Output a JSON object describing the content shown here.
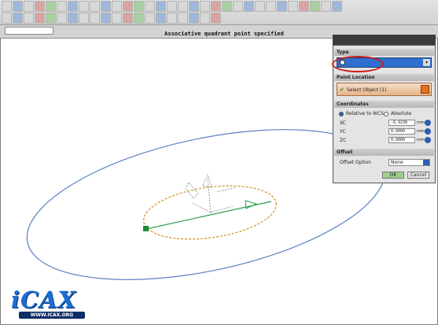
{
  "toolbar": {
    "row1_icons": [
      "new-icon",
      "open-icon",
      "save-icon",
      "undo-icon",
      "redo-icon",
      "cut-icon",
      "copy-icon",
      "paste-icon",
      "delete-icon",
      "sketch-icon",
      "extrude-icon",
      "revolve-icon",
      "sweep-icon",
      "point-icon",
      "datum-icon",
      "line-icon",
      "arc-icon",
      "circle-icon",
      "fillet-icon",
      "chamfer-icon",
      "hole-icon",
      "pattern-icon",
      "mirror-icon",
      "trim-icon",
      "offset-icon",
      "measure-icon",
      "layer-icon",
      "view-icon",
      "render-icon",
      "analysis-icon",
      "help-icon"
    ],
    "row2_icons": [
      "snap-icon",
      "point-snap-icon",
      "end-snap-icon",
      "mid-snap-icon",
      "center-snap-icon",
      "quad-snap-icon",
      "tangent-snap-icon",
      "grid-icon",
      "wcs-icon",
      "orient-icon",
      "filter-icon",
      "select-icon",
      "zoom-icon",
      "pan-icon",
      "rotate-icon",
      "fit-icon",
      "shade-icon",
      "wire-icon",
      "hide-icon",
      "show-icon"
    ]
  },
  "selection_bar": {
    "filter_value": ""
  },
  "status_text": "Associative quadrant point specified",
  "dialog": {
    "title": "",
    "type_section": "Type",
    "type_value": "",
    "point_location_section": "Point Location",
    "select_object_label": "Select Object (1)",
    "coordinates_section": "Coordinates",
    "relative_label": "Relative to WCS",
    "absolute_label": "Absolute",
    "coords": [
      {
        "label": "XC",
        "value": "-6.9238",
        "unit": "mm"
      },
      {
        "label": "YC",
        "value": "0.0000",
        "unit": "mm"
      },
      {
        "label": "ZC",
        "value": "0.0000",
        "unit": "mm"
      }
    ],
    "offset_section": "Offset",
    "offset_option_label": "Offset Option",
    "offset_option_value": "None",
    "ok_label": "OK",
    "cancel_label": "Cancel"
  },
  "logo": {
    "name": "iCAX",
    "url": "WWW.ICAX.ORG"
  },
  "colors": {
    "highlight": "#cc1b1b",
    "large_ellipse": "#5b7fc4",
    "small_ellipse": "#d4982b",
    "axis_line": "#2f9e4e",
    "logo_blue": "#1b6ed6"
  }
}
